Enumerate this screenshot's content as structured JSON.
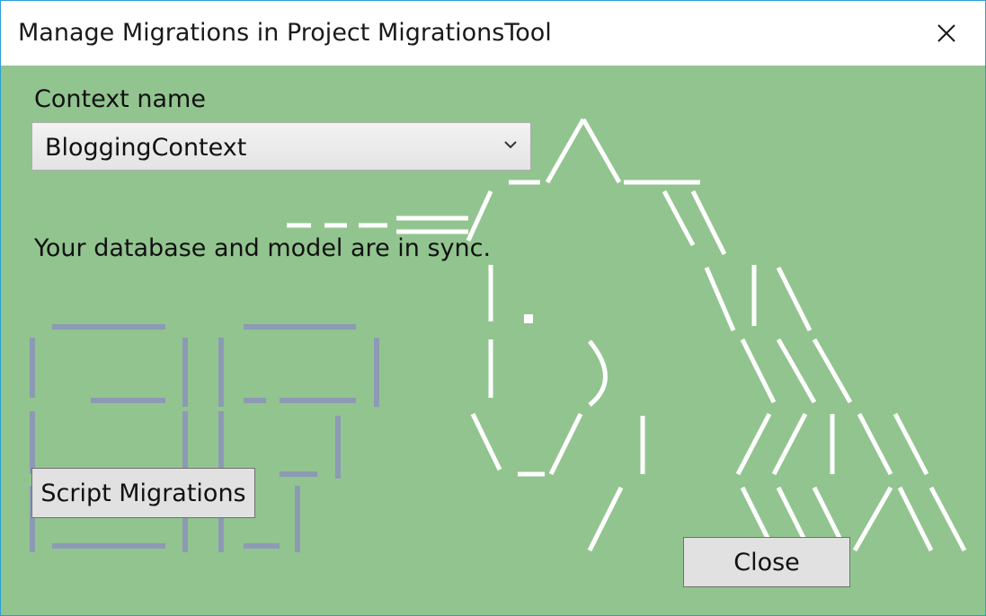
{
  "window": {
    "title": "Manage Migrations in Project MigrationsTool"
  },
  "context": {
    "label": "Context name",
    "selected": "BloggingContext"
  },
  "status": {
    "message": "Your database and model are in sync."
  },
  "buttons": {
    "script_migrations": "Script Migrations",
    "close": "Close"
  },
  "icons": {
    "close": "close-icon",
    "dropdown": "chevron-down-icon"
  },
  "colors": {
    "content_background": "#92c48f",
    "window_border": "#2b9fd6",
    "ef_logo_lines": "#8c9ab4",
    "unicorn_lines": "#ffffff"
  }
}
